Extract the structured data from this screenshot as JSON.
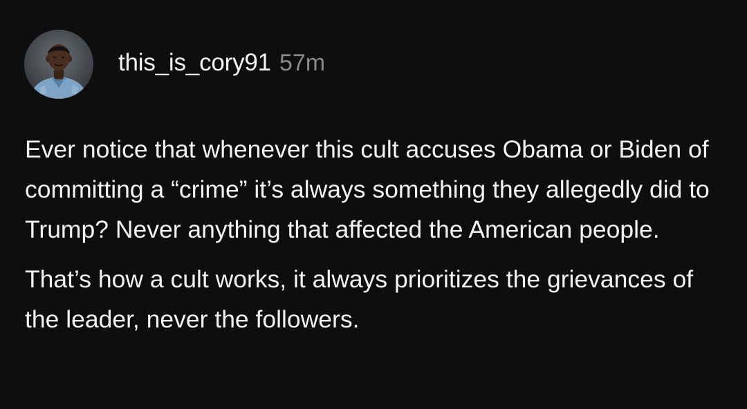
{
  "post": {
    "username": "this_is_cory91",
    "time": "57m",
    "avatar_icon": "profile-photo",
    "paragraphs": [
      "Ever notice that whenever this cult accuses Obama or Biden of committing a “crime” it’s always something they allegedly did to Trump? Never anything that affected the American people.",
      "That’s how a cult works, it always prioritizes the grievances of the leader, never the followers."
    ]
  },
  "colors": {
    "background": "#0e0e0f",
    "text": "#f3f3f3",
    "muted": "#8a8a8a"
  }
}
